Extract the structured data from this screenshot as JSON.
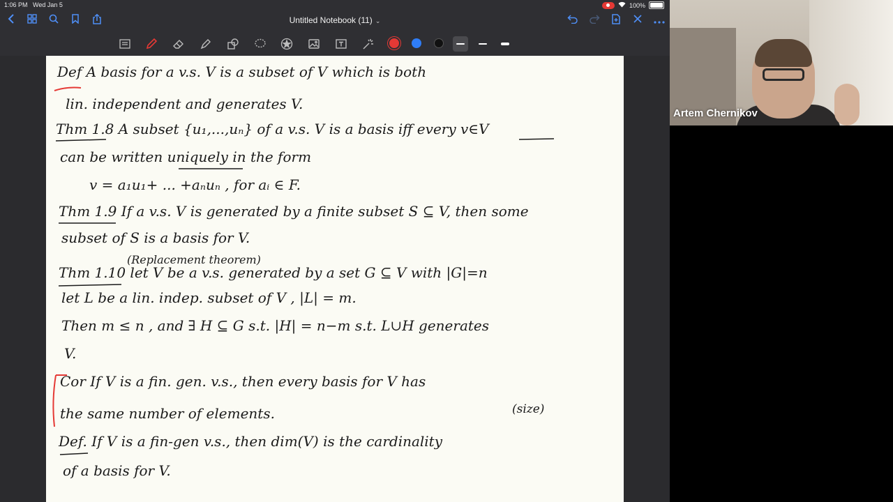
{
  "status_bar": {
    "time": "1:06 PM",
    "date": "Wed Jan 5",
    "battery": "100%"
  },
  "navbar": {
    "title": "Untitled Notebook (11)"
  },
  "toolbar": {
    "colors": {
      "red": "#e53935",
      "blue": "#2f7df6",
      "black": "#111111"
    }
  },
  "video": {
    "participant_name": "Artem Chernikov"
  },
  "notes": {
    "line1": "Def   A basis for a v.s. V is a subset of V which is both",
    "line2": "lin. independent and generates V.",
    "line3": "Thm 1.8  A subset {u₁,...,uₙ} of a v.s. V is a basis iff every v∈V",
    "line4": "can be written uniquely in the form",
    "line5": "v = a₁u₁+ ... +aₙuₙ ,  for aᵢ ∈ F.",
    "line6": "Thm 1.9  If a v.s. V is generated by a finite subset S ⊆ V, then some",
    "line7": "subset of S is a basis for V.",
    "line8a": "(Replacement theorem)",
    "line8": "Thm 1.10  let V be a v.s. generated by a set G ⊆ V with |G|=n",
    "line9": "let L be a lin. indep. subset of V ,  |L| = m.",
    "line10": "Then  m ≤ n , and ∃ H ⊆ G  s.t. |H| = n−m  s.t. L∪H generates",
    "line11": "V.",
    "line12": "Cor   If V is a fin. gen. v.s., then every basis for V has",
    "line13a": "(size)",
    "line13": "the same number of elements.",
    "line14": "Def.  If V is a fin-gen v.s., then dim(V) is the cardinality",
    "line15": "of a basis for V."
  }
}
